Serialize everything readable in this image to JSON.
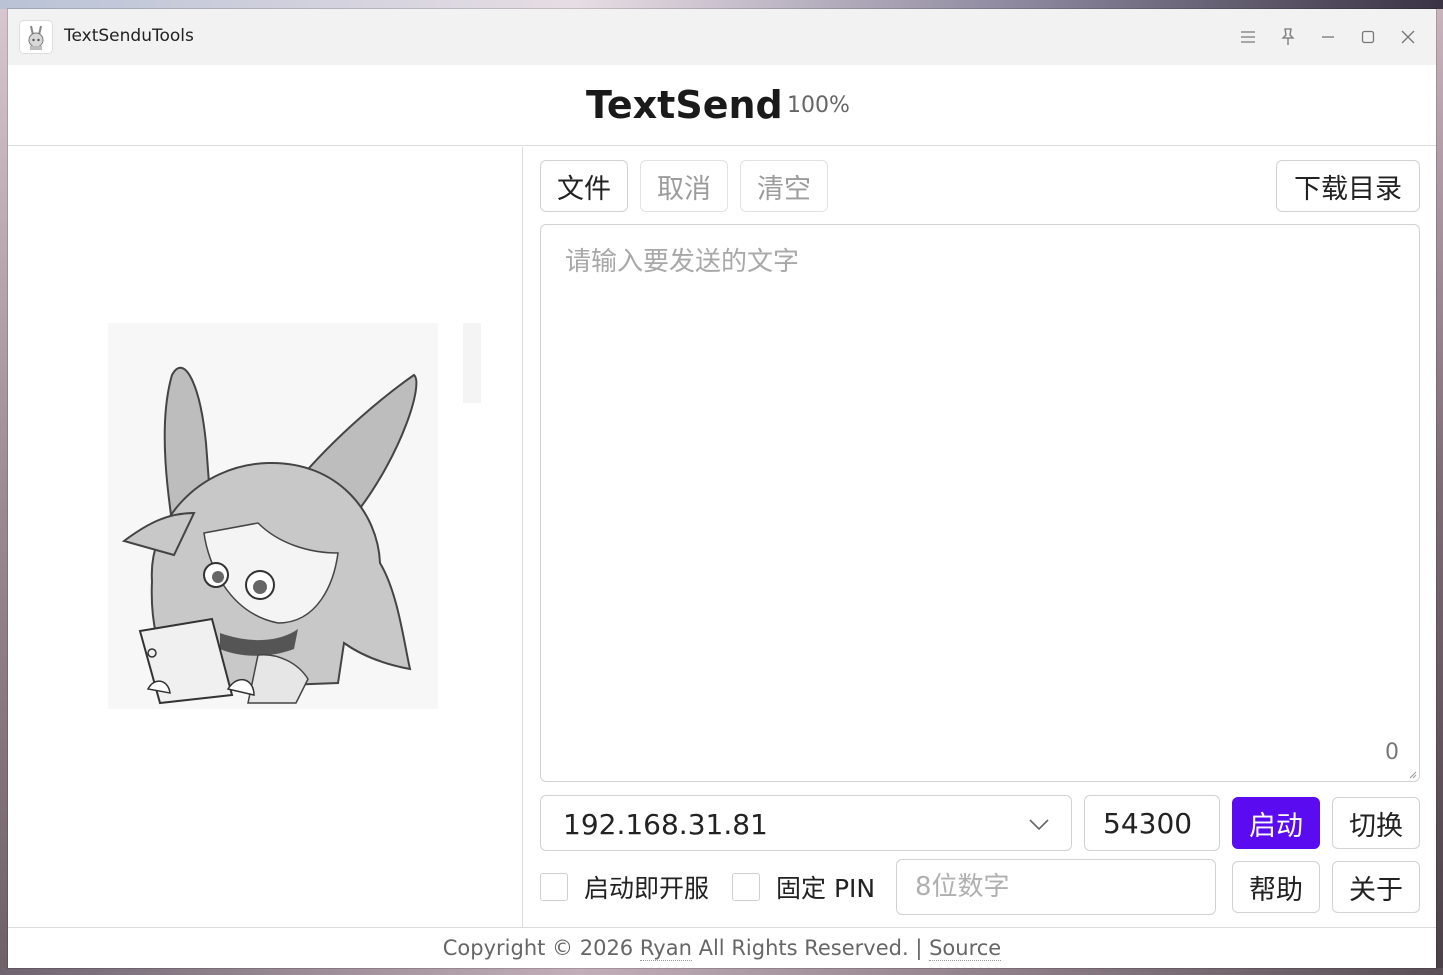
{
  "window": {
    "title": "TextSenduTools"
  },
  "header": {
    "brand": "TextSend",
    "zoom": "100%"
  },
  "toolbar": {
    "file_label": "文件",
    "cancel_label": "取消",
    "clear_label": "清空",
    "download_dir_label": "下载目录"
  },
  "message": {
    "placeholder": "请输入要发送的文字",
    "value": "",
    "char_count": "0"
  },
  "network": {
    "ip_selected": "192.168.31.81",
    "port_value": "54300",
    "start_label": "启动",
    "switch_label": "切换"
  },
  "options": {
    "auto_serve_label": "启动即开服",
    "auto_serve_checked": false,
    "fixed_pin_label": "固定 PIN",
    "fixed_pin_checked": false,
    "pin_placeholder": "8位数字",
    "help_label": "帮助",
    "about_label": "关于"
  },
  "footer": {
    "copyright_prefix": "Copyright © 2026",
    "author": "Ryan",
    "rights": "All Rights Reserved. |",
    "source_label": "Source"
  },
  "colors": {
    "primary": "#5a0bf0",
    "titlebar": "#f2f2f2",
    "border": "#d2d2d2"
  },
  "icons": {
    "titlebar": [
      "menu-icon",
      "pin-icon",
      "minimize-icon",
      "maximize-icon",
      "close-icon"
    ],
    "ip_select": "chevron-down-icon"
  }
}
